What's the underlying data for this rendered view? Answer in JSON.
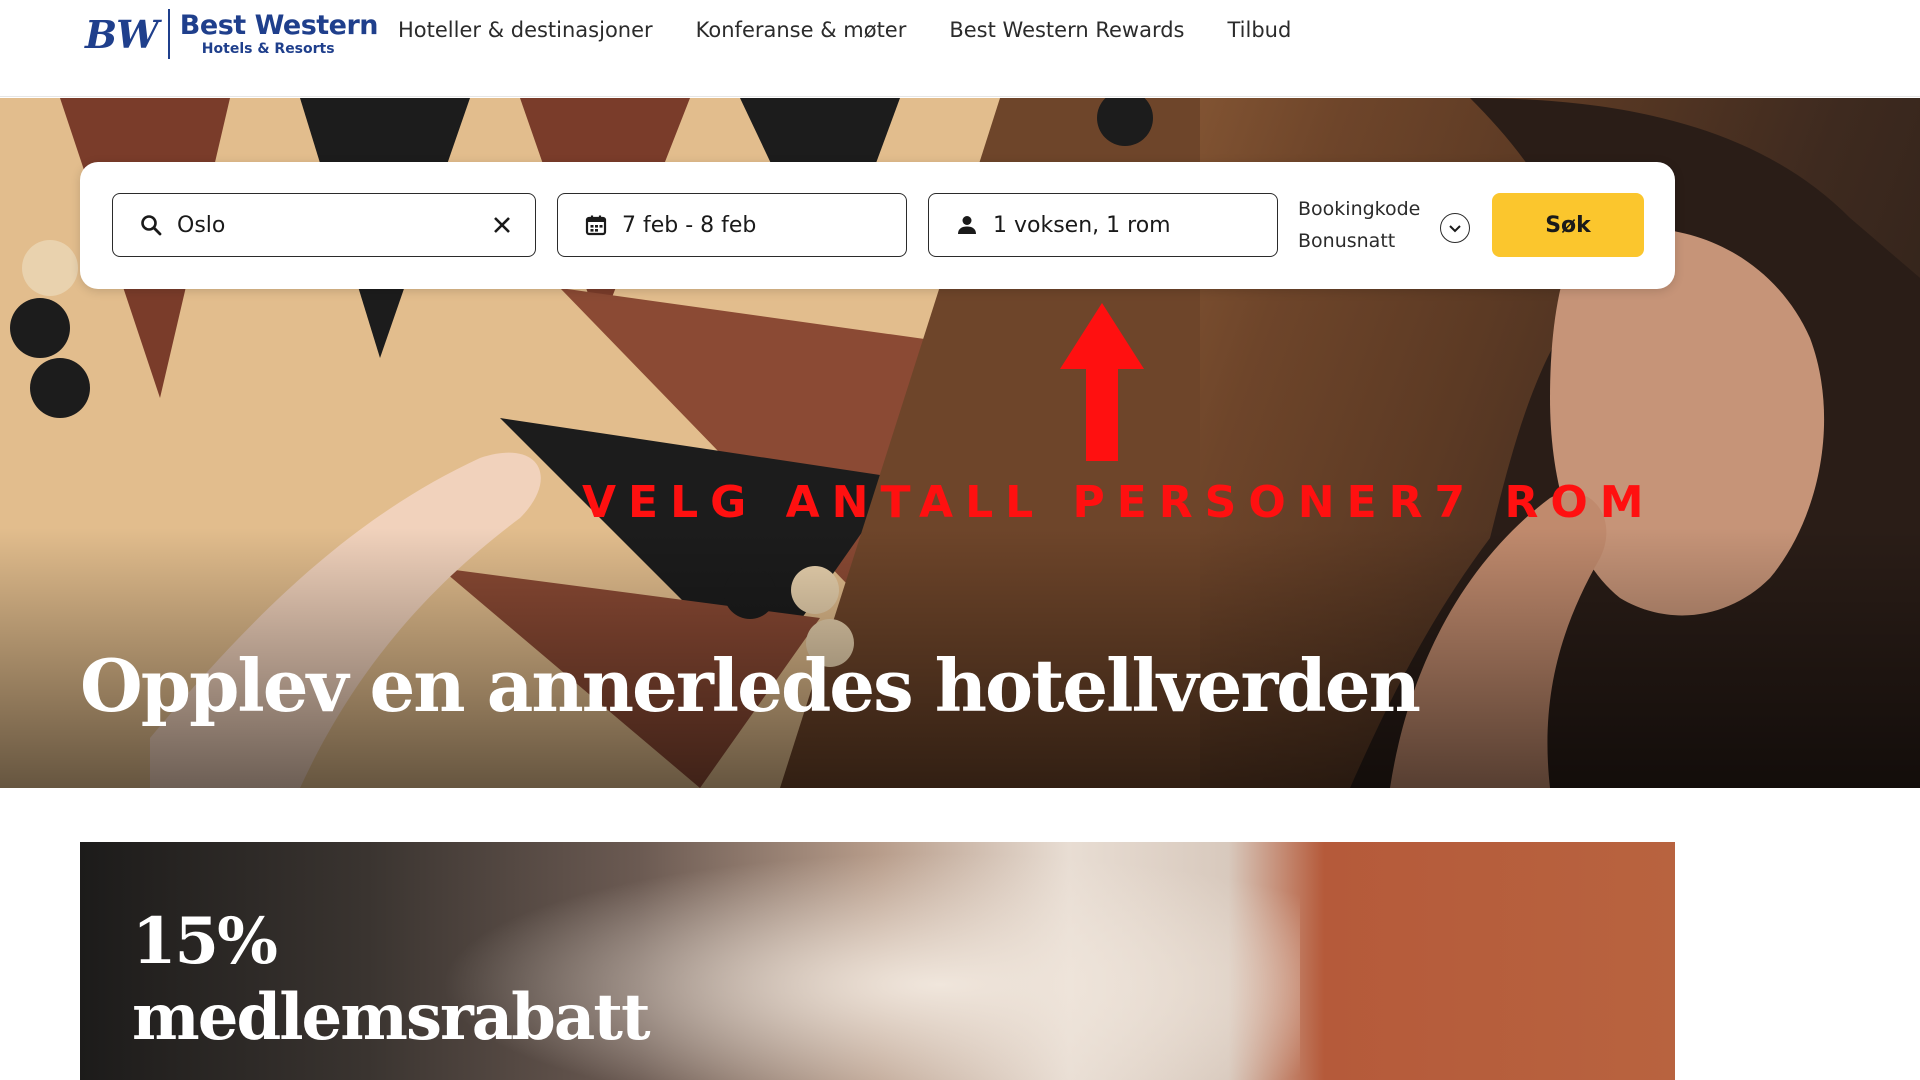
{
  "brand": {
    "logo_mark": "BW",
    "logo_name": "Best Western",
    "logo_sub": "Hotels & Resorts",
    "color": "#1f3f8c"
  },
  "nav": {
    "items": [
      {
        "label": "Hoteller & destinasjoner"
      },
      {
        "label": "Konferanse & møter"
      },
      {
        "label": "Best Western Rewards"
      },
      {
        "label": "Tilbud"
      }
    ]
  },
  "search": {
    "destination": "Oslo",
    "dates": "7 feb - 8 feb",
    "guests": "1 voksen, 1 rom",
    "promo_line1": "Bookingkode",
    "promo_line2": "Bonusnatt",
    "button_label": "Søk",
    "button_color": "#fbc62d"
  },
  "annotation": {
    "text": "VELG ANTALL PERSONER7 ROM",
    "color": "#ff1010"
  },
  "hero": {
    "title": "Opplev en annerledes hotellverden"
  },
  "offer": {
    "line1": "15%",
    "line2": "medlemsrabatt"
  }
}
